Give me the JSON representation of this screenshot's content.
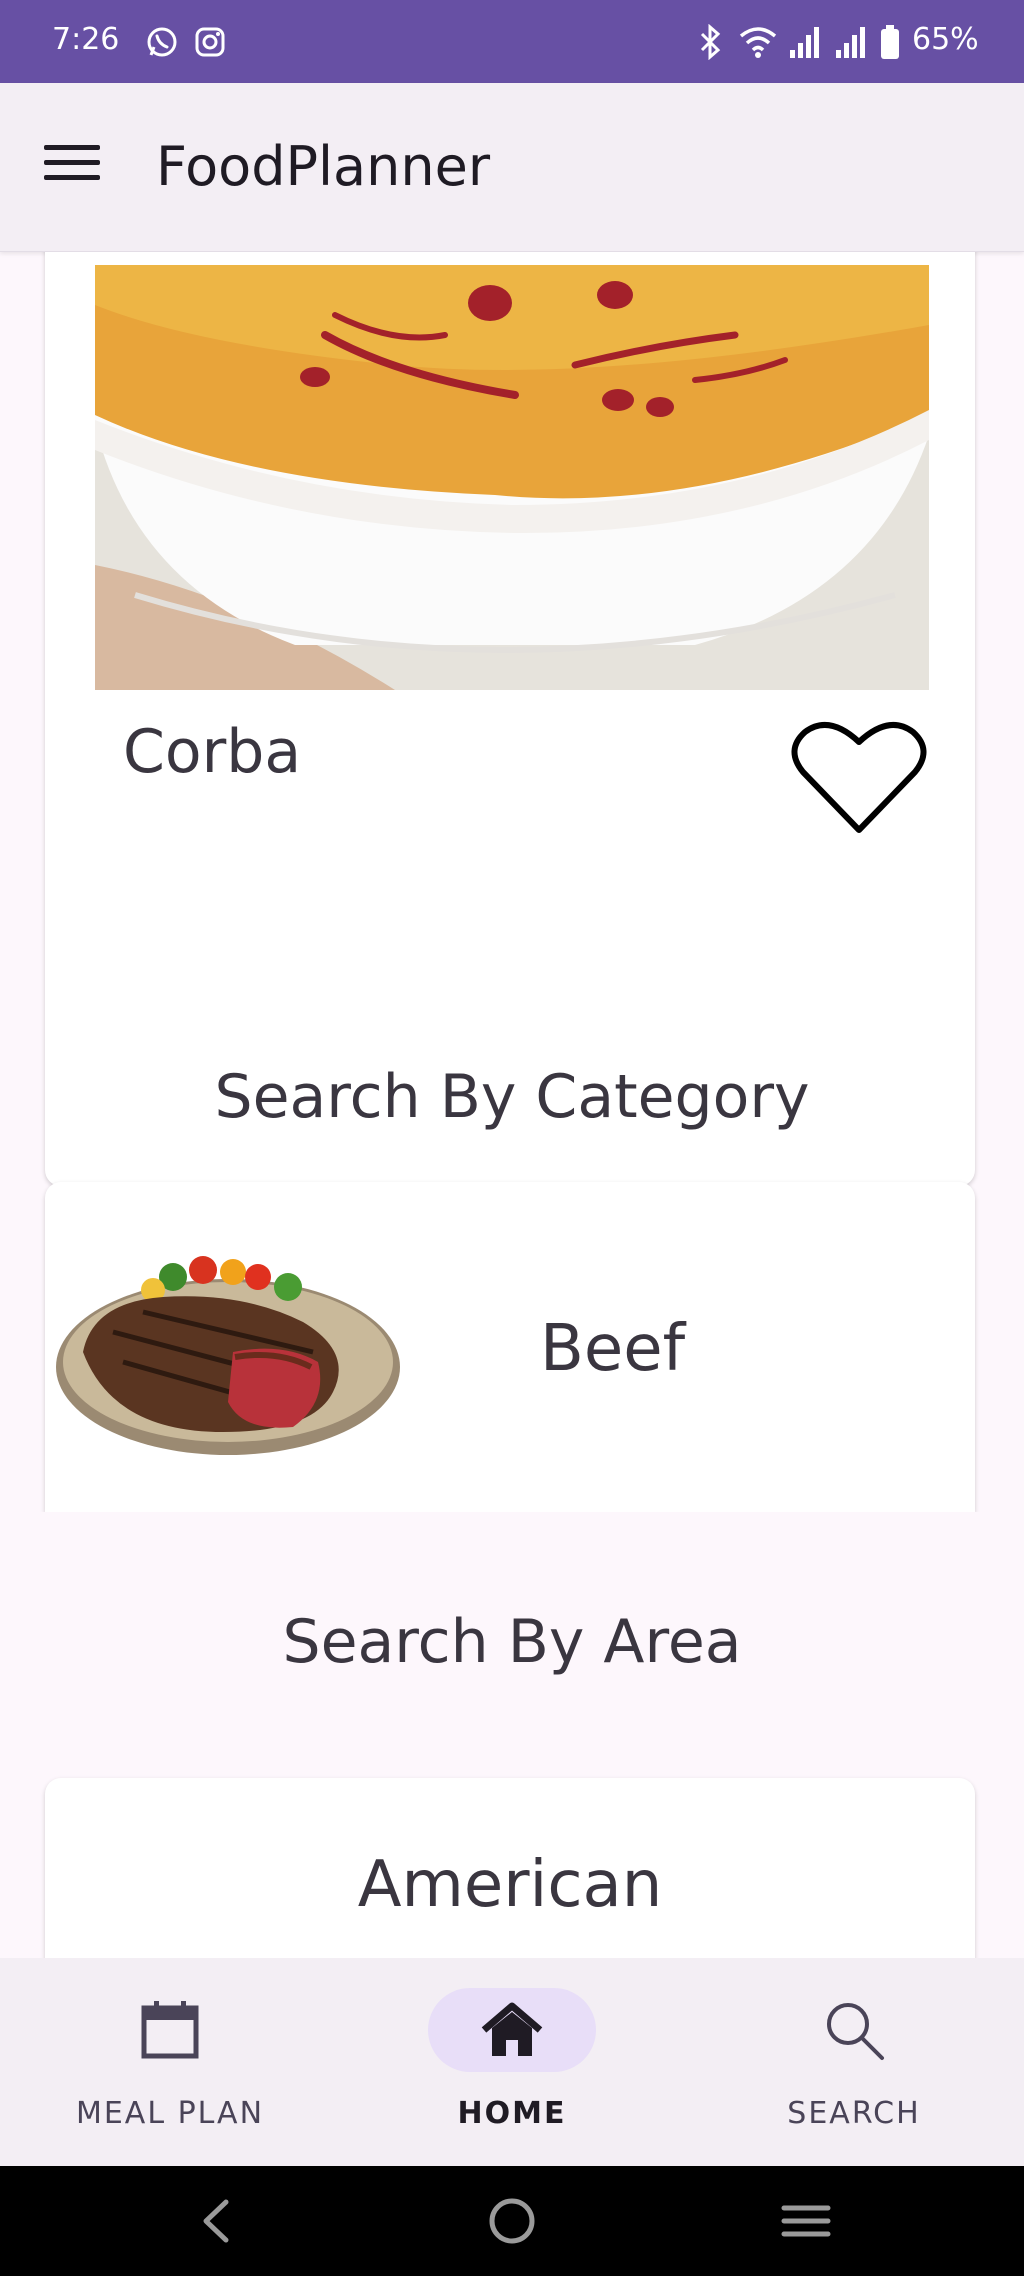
{
  "status_bar": {
    "time": "7:26",
    "battery": "65%",
    "left_icons": [
      "whatsapp-icon",
      "instagram-icon"
    ],
    "right_icons": [
      "bluetooth-icon",
      "wifi-icon",
      "signal-icon",
      "signal-icon",
      "battery-icon"
    ],
    "color": "#6750a4"
  },
  "app_bar": {
    "title": "FoodPlanner",
    "menu_icon": "hamburger-menu-icon"
  },
  "meal_of_day": {
    "name": "Corba",
    "image": "lentil-soup-image",
    "favorite_icon": "heart-outline-icon"
  },
  "category_section": {
    "title": "Search By Category",
    "items": [
      {
        "label": "Beef",
        "image": "grilled-steak-image"
      }
    ]
  },
  "area_section": {
    "title": "Search By Area",
    "items": [
      {
        "label": "American"
      }
    ]
  },
  "bottom_nav": {
    "items": [
      {
        "label": "MEAL PLAN",
        "icon": "calendar-icon",
        "active": false
      },
      {
        "label": "HOME",
        "icon": "home-icon",
        "active": true
      },
      {
        "label": "SEARCH",
        "icon": "search-icon",
        "active": false
      }
    ],
    "active_indicator_color": "#e8def8"
  },
  "system_nav": {
    "buttons": [
      "back-icon",
      "home-circle-icon",
      "recents-icon"
    ]
  }
}
